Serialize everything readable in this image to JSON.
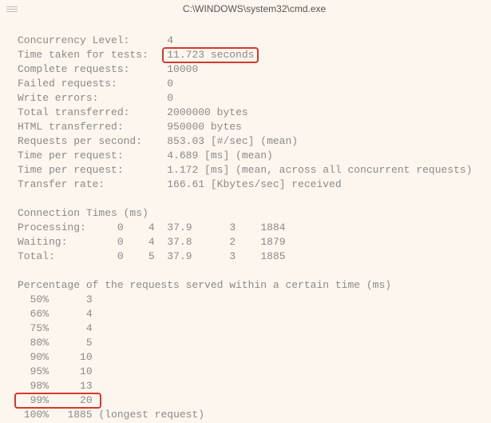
{
  "window": {
    "title": "C:\\WINDOWS\\system32\\cmd.exe"
  },
  "summary": {
    "concurrency_label": "Concurrency Level:",
    "concurrency_value": "4",
    "time_taken_label": "Time taken for tests:",
    "time_taken_value": "11.723 seconds",
    "complete_label": "Complete requests:",
    "complete_value": "10000",
    "failed_label": "Failed requests:",
    "failed_value": "0",
    "write_errors_label": "Write errors:",
    "write_errors_value": "0",
    "total_transferred_label": "Total transferred:",
    "total_transferred_value": "2000000 bytes",
    "html_transferred_label": "HTML transferred:",
    "html_transferred_value": "950000 bytes",
    "rps_label": "Requests per second:",
    "rps_value": "853.03 [#/sec] (mean)",
    "tpr1_label": "Time per request:",
    "tpr1_value": "4.689 [ms] (mean)",
    "tpr2_label": "Time per request:",
    "tpr2_value": "1.172 [ms] (mean, across all concurrent requests)",
    "transfer_label": "Transfer rate:",
    "transfer_value": "166.61 [Kbytes/sec] received"
  },
  "conn_times": {
    "header": "Connection Times (ms)",
    "rows": {
      "processing": {
        "label": "Processing:",
        "min": "0",
        "mean": "4",
        "sd": "37.9",
        "median": "3",
        "max": "1884"
      },
      "waiting": {
        "label": "Waiting:",
        "min": "0",
        "mean": "4",
        "sd": "37.8",
        "median": "2",
        "max": "1879"
      },
      "total": {
        "label": "Total:",
        "min": "0",
        "mean": "5",
        "sd": "37.9",
        "median": "3",
        "max": "1885"
      }
    }
  },
  "percentiles": {
    "header": "Percentage of the requests served within a certain time (ms)",
    "rows": {
      "p50": {
        "pct": "50%",
        "val": "3"
      },
      "p66": {
        "pct": "66%",
        "val": "4"
      },
      "p75": {
        "pct": "75%",
        "val": "4"
      },
      "p80": {
        "pct": "80%",
        "val": "5"
      },
      "p90": {
        "pct": "90%",
        "val": "10"
      },
      "p95": {
        "pct": "95%",
        "val": "10"
      },
      "p98": {
        "pct": "98%",
        "val": "13"
      },
      "p99": {
        "pct": "99%",
        "val": "20"
      },
      "p100": {
        "pct": "100%",
        "val": "1885",
        "note": "(longest request)"
      }
    }
  },
  "highlights": {
    "time_taken": true,
    "p99": true
  }
}
